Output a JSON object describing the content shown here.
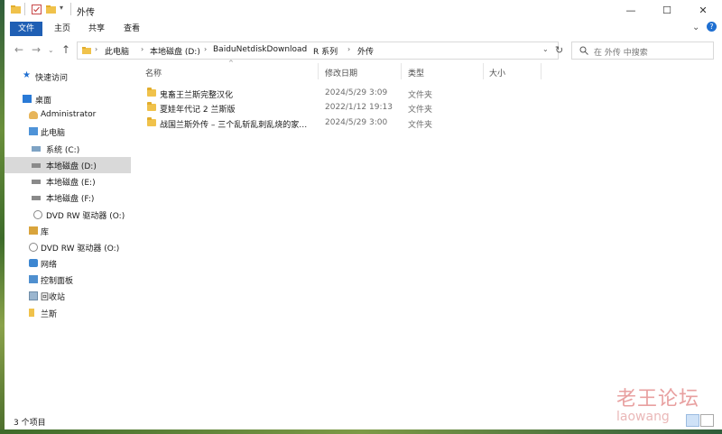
{
  "window": {
    "title": "外传",
    "minimize_glyph": "—",
    "maximize_glyph": "☐",
    "close_glyph": "✕"
  },
  "ribbon": {
    "tabs": [
      "文件",
      "主页",
      "共享",
      "查看"
    ]
  },
  "address": {
    "crumbs": [
      "此电脑",
      "本地磁盘 (D:)",
      "BaiduNetdiskDownload",
      "R 系列",
      "外传"
    ],
    "search_placeholder": "在 外传 中搜索"
  },
  "nav": {
    "items": [
      {
        "label": "快速访问",
        "icon": "star-icon"
      },
      {
        "label": "桌面",
        "icon": "desktop-icon"
      },
      {
        "label": "Administrator",
        "icon": "user-icon"
      },
      {
        "label": "此电脑",
        "icon": "computer-icon"
      },
      {
        "label": "系统 (C:)",
        "icon": "drive-icon"
      },
      {
        "label": "本地磁盘 (D:)",
        "icon": "drive-icon"
      },
      {
        "label": "本地磁盘 (E:)",
        "icon": "drive-icon"
      },
      {
        "label": "本地磁盘 (F:)",
        "icon": "drive-icon"
      },
      {
        "label": "DVD RW 驱动器 (O:)",
        "icon": "dvd-icon"
      },
      {
        "label": "库",
        "icon": "library-icon"
      },
      {
        "label": "DVD RW 驱动器 (O:)",
        "icon": "dvd-icon"
      },
      {
        "label": "网络",
        "icon": "network-icon"
      },
      {
        "label": "控制面板",
        "icon": "control-panel-icon"
      },
      {
        "label": "回收站",
        "icon": "recycle-bin-icon"
      },
      {
        "label": "兰斯",
        "icon": "folder-icon"
      }
    ],
    "selected": "本地磁盘 (D:)"
  },
  "columns": {
    "name": "名称",
    "modified": "修改日期",
    "type": "类型",
    "size": "大小"
  },
  "files": [
    {
      "name": "鬼畜王兰斯完整汉化",
      "modified": "2024/5/29 3:09",
      "type": "文件夹"
    },
    {
      "name": "夏娃年代记 2 兰斯版",
      "modified": "2022/1/12 19:13",
      "type": "文件夹"
    },
    {
      "name": "战国兰斯外传 – 三个乱斩乱刺乱烧的家…",
      "modified": "2024/5/29 3:00",
      "type": "文件夹"
    }
  ],
  "status": {
    "count": "3 个项目"
  },
  "watermark": {
    "cn": "老王论坛",
    "en": "laowang"
  },
  "colors": {
    "file_tab": "#1f5fb4",
    "folder": "#f0c24b",
    "selection": "#d9d9d9"
  }
}
